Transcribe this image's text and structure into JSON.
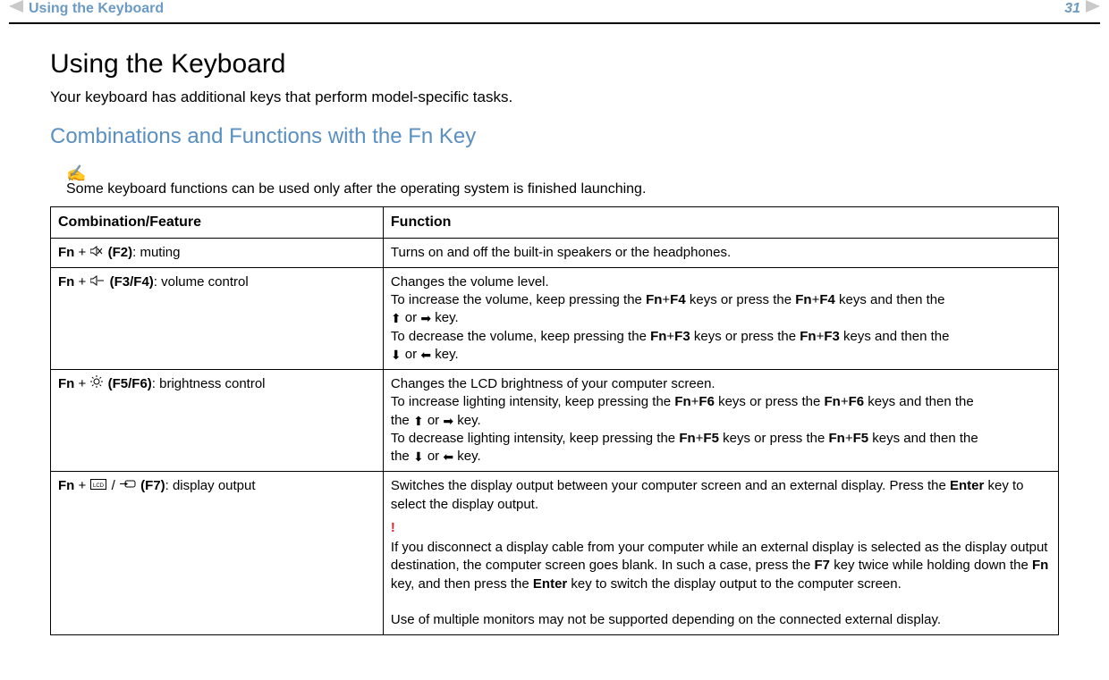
{
  "header": {
    "breadcrumb": "Using the Keyboard",
    "page_number": "31"
  },
  "main": {
    "title": "Using the Keyboard",
    "intro": "Your keyboard has additional keys that perform model-specific tasks.",
    "subtitle": "Combinations and Functions with the Fn Key",
    "note_icon": "✍",
    "note": "Some keyboard functions can be used only after the operating system is finished launching."
  },
  "table": {
    "headers": [
      "Combination/Feature",
      "Function"
    ],
    "rows": [
      {
        "combo_prefix": "Fn",
        "combo_keys": "(F2)",
        "combo_label": ": muting",
        "icon": "mute",
        "function_plain": "Turns on and off the built-in speakers or the headphones."
      },
      {
        "combo_prefix": "Fn",
        "combo_keys": "(F3/F4)",
        "combo_label": ": volume control",
        "icon": "volume",
        "func": {
          "line1": "Changes the volume level.",
          "inc_a": "To increase the volume, keep pressing the ",
          "inc_k1": "Fn",
          "inc_plus1": "+",
          "inc_k2": "F4",
          "inc_b": " keys or press the ",
          "inc_k3": "Fn",
          "inc_plus2": "+",
          "inc_k4": "F4",
          "inc_c": " keys and then the ",
          "inc_or": " or ",
          "inc_d": " key.",
          "dec_a": "To decrease the volume, keep pressing the ",
          "dec_k1": "Fn",
          "dec_plus1": "+",
          "dec_k2": "F3",
          "dec_b": " keys or press the ",
          "dec_k3": "Fn",
          "dec_plus2": "+",
          "dec_k4": "F3",
          "dec_c": " keys and then the ",
          "dec_or": " or ",
          "dec_d": " key."
        }
      },
      {
        "combo_prefix": "Fn",
        "combo_keys": "(F5/F6)",
        "combo_label": ": brightness control",
        "icon": "brightness",
        "func": {
          "line1": "Changes the LCD brightness of your computer screen.",
          "inc_a": "To increase lighting intensity, keep pressing the ",
          "inc_k1": "Fn",
          "inc_plus1": "+",
          "inc_k2": "F6",
          "inc_b": " keys or press the ",
          "inc_k3": "Fn",
          "inc_plus2": "+",
          "inc_k4": "F6",
          "inc_c": " keys and then the ",
          "inc_or": " or ",
          "inc_d": " key.",
          "dec_a": "To decrease lighting intensity, keep pressing the ",
          "dec_k1": "Fn",
          "dec_plus1": "+",
          "dec_k2": "F5",
          "dec_b": " keys or press the ",
          "dec_k3": "Fn",
          "dec_plus2": "+",
          "dec_k4": "F5",
          "dec_c": " keys and then the ",
          "dec_or": " or ",
          "dec_d": " key."
        }
      },
      {
        "combo_prefix": "Fn",
        "combo_keys": "(F7)",
        "combo_label": ": display output",
        "icon": "display",
        "func": {
          "p1a": "Switches the display output between your computer screen and an external display. Press the ",
          "p1k": "Enter",
          "p1b": " key to select the display output.",
          "excl": "!",
          "p2a": "If you disconnect a display cable from your computer while an external display is selected as the display output destination, the computer screen goes blank. In such a case, press the ",
          "p2k1": "F7",
          "p2b": " key twice while holding down the ",
          "p2k2": "Fn",
          "p2c": " key, and then press the ",
          "p2k3": "Enter",
          "p2d": " key to switch the display output to the computer screen.",
          "p3": "Use of multiple monitors may not be supported depending on the connected external display."
        }
      }
    ]
  }
}
